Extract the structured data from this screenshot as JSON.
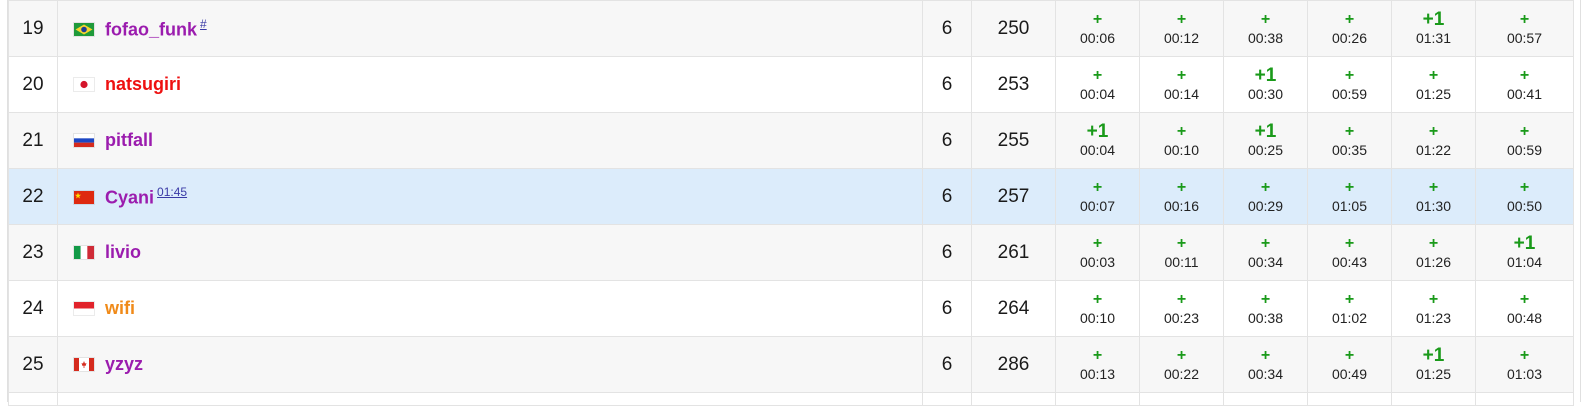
{
  "rows": [
    {
      "rank": "19",
      "flag": "br",
      "flag_icon": "brazil-flag-icon",
      "name": "fofao_funk",
      "sup": "#",
      "name_color": "#9b1cae",
      "solved": "6",
      "penalty": "250",
      "problems": [
        {
          "v": "+",
          "t": "00:06"
        },
        {
          "v": "+",
          "t": "00:12"
        },
        {
          "v": "+",
          "t": "00:38"
        },
        {
          "v": "+",
          "t": "00:26"
        },
        {
          "v": "+1",
          "t": "01:31"
        },
        {
          "v": "+",
          "t": "00:57"
        }
      ]
    },
    {
      "rank": "20",
      "flag": "jp",
      "flag_icon": "japan-flag-icon",
      "name": "natsugiri",
      "sup": "",
      "name_color": "#ee1111",
      "solved": "6",
      "penalty": "253",
      "problems": [
        {
          "v": "+",
          "t": "00:04"
        },
        {
          "v": "+",
          "t": "00:14"
        },
        {
          "v": "+1",
          "t": "00:30"
        },
        {
          "v": "+",
          "t": "00:59"
        },
        {
          "v": "+",
          "t": "01:25"
        },
        {
          "v": "+",
          "t": "00:41"
        }
      ]
    },
    {
      "rank": "21",
      "flag": "ru",
      "flag_icon": "russia-flag-icon",
      "name": "pitfall",
      "sup": "",
      "name_color": "#9b1cae",
      "solved": "6",
      "penalty": "255",
      "problems": [
        {
          "v": "+1",
          "t": "00:04"
        },
        {
          "v": "+",
          "t": "00:10"
        },
        {
          "v": "+1",
          "t": "00:25"
        },
        {
          "v": "+",
          "t": "00:35"
        },
        {
          "v": "+",
          "t": "01:22"
        },
        {
          "v": "+",
          "t": "00:59"
        }
      ]
    },
    {
      "rank": "22",
      "flag": "cn",
      "flag_icon": "china-flag-icon",
      "name": "Cyani",
      "sup": "01:45",
      "name_color": "#9b1cae",
      "solved": "6",
      "penalty": "257",
      "highlight": true,
      "problems": [
        {
          "v": "+",
          "t": "00:07"
        },
        {
          "v": "+",
          "t": "00:16"
        },
        {
          "v": "+",
          "t": "00:29"
        },
        {
          "v": "+",
          "t": "01:05"
        },
        {
          "v": "+",
          "t": "01:30"
        },
        {
          "v": "+",
          "t": "00:50"
        }
      ]
    },
    {
      "rank": "23",
      "flag": "it",
      "flag_icon": "italy-flag-icon",
      "name": "livio",
      "sup": "",
      "name_color": "#9b1cae",
      "solved": "6",
      "penalty": "261",
      "problems": [
        {
          "v": "+",
          "t": "00:03"
        },
        {
          "v": "+",
          "t": "00:11"
        },
        {
          "v": "+",
          "t": "00:34"
        },
        {
          "v": "+",
          "t": "00:43"
        },
        {
          "v": "+",
          "t": "01:26"
        },
        {
          "v": "+1",
          "t": "01:04"
        }
      ]
    },
    {
      "rank": "24",
      "flag": "id",
      "flag_icon": "indonesia-flag-icon",
      "name": "wifi",
      "sup": "",
      "name_color": "#f08a18",
      "solved": "6",
      "penalty": "264",
      "problems": [
        {
          "v": "+",
          "t": "00:10"
        },
        {
          "v": "+",
          "t": "00:23"
        },
        {
          "v": "+",
          "t": "00:38"
        },
        {
          "v": "+",
          "t": "01:02"
        },
        {
          "v": "+",
          "t": "01:23"
        },
        {
          "v": "+",
          "t": "00:48"
        }
      ]
    },
    {
      "rank": "25",
      "flag": "ca",
      "flag_icon": "canada-flag-icon",
      "name": "yzyz",
      "sup": "",
      "name_color": "#9b1cae",
      "solved": "6",
      "penalty": "286",
      "problems": [
        {
          "v": "+",
          "t": "00:13"
        },
        {
          "v": "+",
          "t": "00:22"
        },
        {
          "v": "+",
          "t": "00:34"
        },
        {
          "v": "+",
          "t": "00:49"
        },
        {
          "v": "+1",
          "t": "01:25"
        },
        {
          "v": "+",
          "t": "01:03"
        }
      ]
    }
  ],
  "colors": {
    "accepted": "#1a9a1a",
    "highlight_row": "#dcecfb",
    "odd_row": "#f7f7f7"
  }
}
